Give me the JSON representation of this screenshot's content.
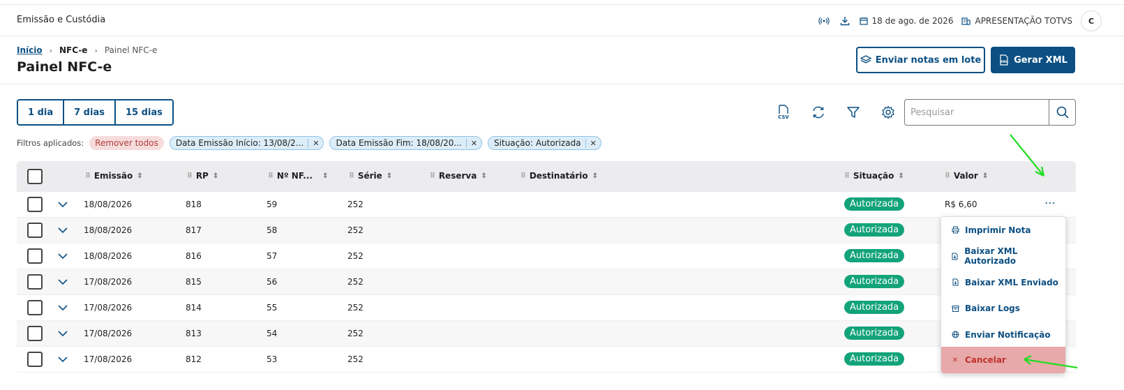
{
  "topbar": {
    "app_title": "Emissão e Custódia",
    "date": "18 de ago. de 2026",
    "company": "APRESENTAÇÃO TOTVS",
    "avatar_initial": "C"
  },
  "breadcrumb": {
    "home": "Início",
    "section": "NFC-e",
    "current": "Painel NFC-e"
  },
  "page": {
    "title": "Painel NFC-e",
    "send_batch_label": "Enviar notas em lote",
    "generate_xml_label": "Gerar XML"
  },
  "periods": [
    "1 dia",
    "7 dias",
    "15 dias"
  ],
  "search": {
    "placeholder": "Pesquisar"
  },
  "filters": {
    "label": "Filtros aplicados:",
    "remove_all": "Remover todos",
    "chips": [
      "Data Emissão Início: 13/08/2...",
      "Data Emissão Fim: 18/08/20...",
      "Situação: Autorizada"
    ]
  },
  "table": {
    "columns": {
      "emissao": "Emissão",
      "rp": "RP",
      "nf": "Nº NF...",
      "serie": "Série",
      "reserva": "Reserva",
      "destinatario": "Destinatário",
      "situacao": "Situação",
      "valor": "Valor"
    },
    "rows": [
      {
        "emissao": "18/08/2026",
        "rp": "818",
        "nf": "59",
        "serie": "252",
        "situacao": "Autorizada",
        "valor": "R$ 6,60"
      },
      {
        "emissao": "18/08/2026",
        "rp": "817",
        "nf": "58",
        "serie": "252",
        "situacao": "Autorizada",
        "valor": ""
      },
      {
        "emissao": "18/08/2026",
        "rp": "816",
        "nf": "57",
        "serie": "252",
        "situacao": "Autorizada",
        "valor": ""
      },
      {
        "emissao": "17/08/2026",
        "rp": "815",
        "nf": "56",
        "serie": "252",
        "situacao": "Autorizada",
        "valor": ""
      },
      {
        "emissao": "17/08/2026",
        "rp": "814",
        "nf": "55",
        "serie": "252",
        "situacao": "Autorizada",
        "valor": ""
      },
      {
        "emissao": "17/08/2026",
        "rp": "813",
        "nf": "54",
        "serie": "252",
        "situacao": "Autorizada",
        "valor": ""
      },
      {
        "emissao": "17/08/2026",
        "rp": "812",
        "nf": "53",
        "serie": "252",
        "situacao": "Autorizada",
        "valor": ""
      }
    ]
  },
  "menu": {
    "print": "Imprimir Nota",
    "download_xml_authorized": "Baixar XML Autorizado",
    "download_xml_sent": "Baixar XML Enviado",
    "download_logs": "Baixar Logs",
    "send_notification": "Enviar Notificação",
    "cancel": "Cancelar"
  },
  "icons": {
    "csv_label": "CSV",
    "xml_label": "XML"
  },
  "colors": {
    "primary": "#0c4f82",
    "success": "#12a37a",
    "danger": "#c0302d",
    "annotation_arrow": "#22dd22"
  }
}
